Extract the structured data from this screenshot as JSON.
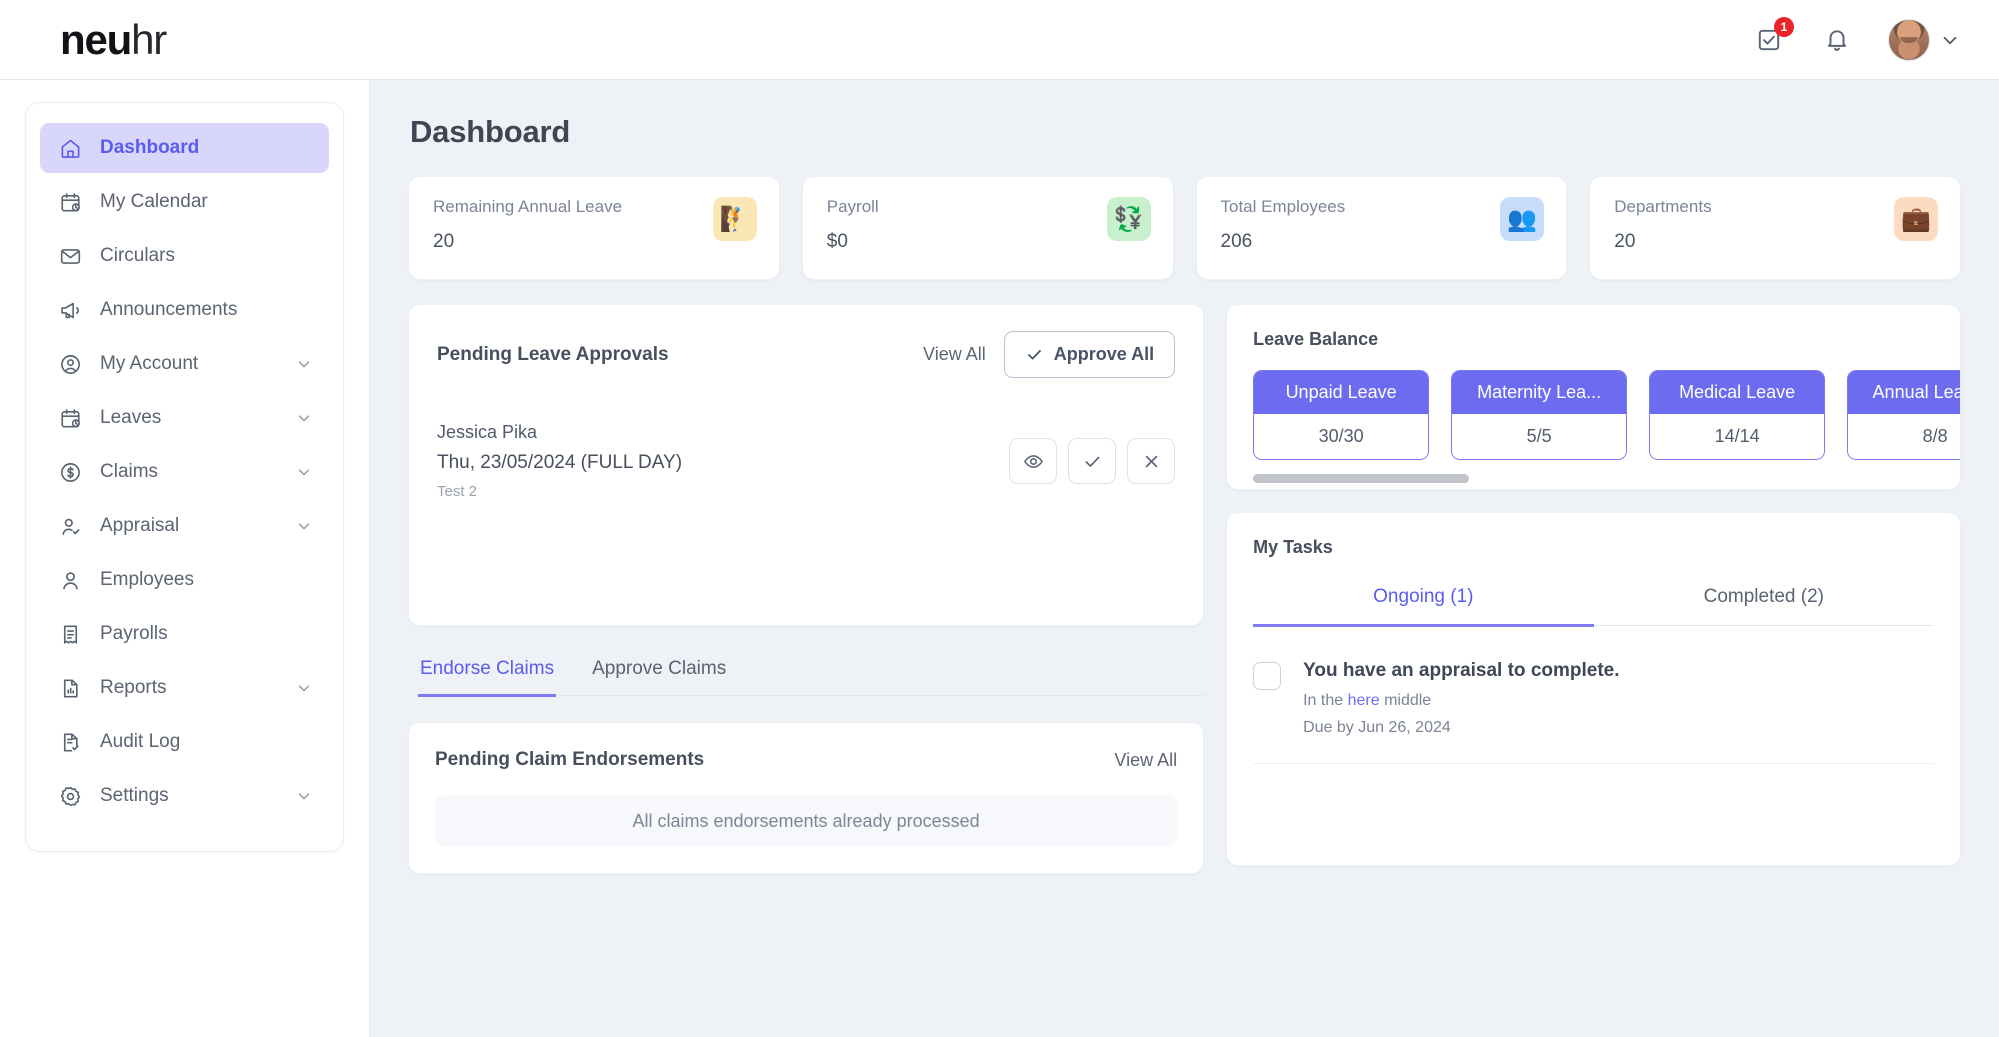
{
  "header": {
    "logo_bold": "neu",
    "logo_light": "hr",
    "tasks_badge": "1",
    "tasks_icon": "checkbox-task-icon",
    "bell_icon": "bell-icon",
    "avatar_icon": "user-avatar",
    "chevron_icon": "chevron-down-icon"
  },
  "sidebar": {
    "items": [
      {
        "label": "Dashboard",
        "icon": "home-icon",
        "active": true,
        "expandable": false
      },
      {
        "label": "My Calendar",
        "icon": "calendar-icon",
        "active": false,
        "expandable": false
      },
      {
        "label": "Circulars",
        "icon": "envelope-icon",
        "active": false,
        "expandable": false
      },
      {
        "label": "Announcements",
        "icon": "megaphone-icon",
        "active": false,
        "expandable": false
      },
      {
        "label": "My Account",
        "icon": "user-circle-icon",
        "active": false,
        "expandable": true
      },
      {
        "label": "Leaves",
        "icon": "calendar-icon",
        "active": false,
        "expandable": true
      },
      {
        "label": "Claims",
        "icon": "dollar-circle-icon",
        "active": false,
        "expandable": true
      },
      {
        "label": "Appraisal",
        "icon": "user-check-icon",
        "active": false,
        "expandable": true
      },
      {
        "label": "Employees",
        "icon": "user-icon",
        "active": false,
        "expandable": false
      },
      {
        "label": "Payrolls",
        "icon": "receipt-icon",
        "active": false,
        "expandable": false
      },
      {
        "label": "Reports",
        "icon": "document-chart-icon",
        "active": false,
        "expandable": true
      },
      {
        "label": "Audit Log",
        "icon": "document-check-icon",
        "active": false,
        "expandable": false
      },
      {
        "label": "Settings",
        "icon": "gear-icon",
        "active": false,
        "expandable": true
      }
    ]
  },
  "main": {
    "page_title": "Dashboard",
    "stats": [
      {
        "label": "Remaining Annual Leave",
        "value": "20",
        "icon": "hiking-person-icon",
        "glyph": "🧗",
        "bg": "#fbe7b4",
        "fg": "#8a6a16"
      },
      {
        "label": "Payroll",
        "value": "$0",
        "icon": "money-exchange-icon",
        "glyph": "💱",
        "bg": "#c9f0cd",
        "fg": "#1c6e2c"
      },
      {
        "label": "Total Employees",
        "value": "206",
        "icon": "people-icon",
        "glyph": "👥",
        "bg": "#c5dcfa",
        "fg": "#14458f"
      },
      {
        "label": "Departments",
        "value": "20",
        "icon": "briefcase-icon",
        "glyph": "💼",
        "bg": "#fbdcc2",
        "fg": "#9a4a11"
      }
    ],
    "pending_leave": {
      "title": "Pending Leave Approvals",
      "view_all": "View All",
      "approve_all": "Approve All",
      "approve_all_icon": "check-icon",
      "request": {
        "name": "Jessica Pika",
        "date": "Thu, 23/05/2024 (FULL DAY)",
        "note": "Test 2",
        "actions": [
          {
            "name": "view-leave-button",
            "icon": "eye-icon"
          },
          {
            "name": "approve-leave-button",
            "icon": "check-icon"
          },
          {
            "name": "reject-leave-button",
            "icon": "close-icon"
          }
        ]
      }
    },
    "claim_tabs": [
      {
        "label": "Endorse Claims",
        "active": true
      },
      {
        "label": "Approve Claims",
        "active": false
      }
    ],
    "claims_card": {
      "title": "Pending Claim Endorsements",
      "view_all": "View All",
      "empty_message": "All claims endorsements already processed"
    },
    "leave_balance": {
      "title": "Leave Balance",
      "items": [
        {
          "label": "Unpaid Leave",
          "value": "30/30"
        },
        {
          "label": "Maternity Lea...",
          "value": "5/5"
        },
        {
          "label": "Medical Leave",
          "value": "14/14"
        },
        {
          "label": "Annual Leave...",
          "value": "8/8"
        }
      ]
    },
    "my_tasks": {
      "title": "My Tasks",
      "tabs": [
        {
          "label": "Ongoing (1)",
          "active": true
        },
        {
          "label": "Completed (2)",
          "active": false
        }
      ],
      "task": {
        "title": "You have an appraisal to complete.",
        "sub_prefix": "In the ",
        "sub_link": "here",
        "sub_suffix": " middle",
        "due": "Due by Jun 26, 2024"
      }
    }
  },
  "colors": {
    "accent": "#5b5bf0",
    "accent_soft": "#d9d6fb",
    "page_bg": "#eef1f6",
    "badge_red": "#e8242a",
    "leave_header": "#6d6cf0"
  }
}
